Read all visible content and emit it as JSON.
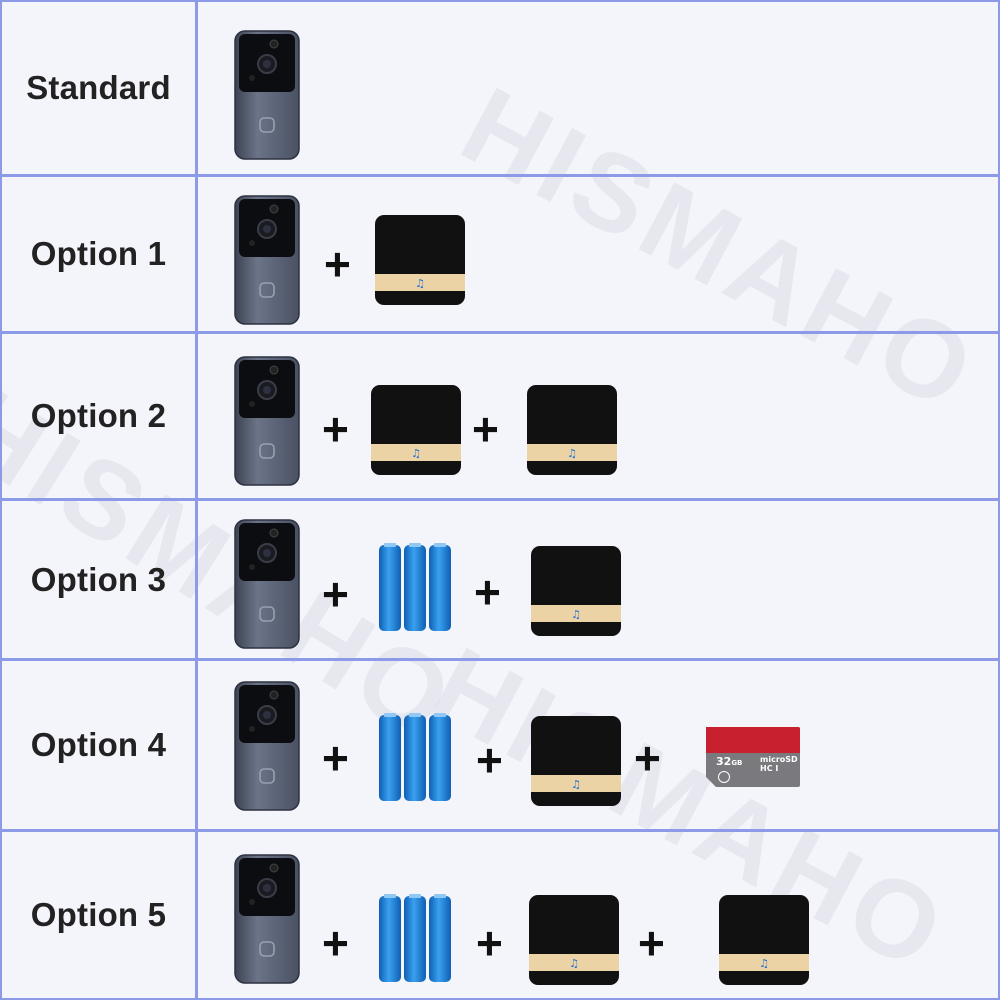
{
  "watermark": "HISMAHO",
  "rows": [
    {
      "label": "Standard"
    },
    {
      "label": "Option 1"
    },
    {
      "label": "Option 2"
    },
    {
      "label": "Option 3"
    },
    {
      "label": "Option 4"
    },
    {
      "label": "Option 5"
    }
  ],
  "plus_sign": "+",
  "sd_card": {
    "capacity": "32",
    "unit": "GB",
    "brand": "micro",
    "format": "SD",
    "class_mark": "HC I"
  },
  "colors": {
    "border": "#8d9ae8",
    "doorbell_body": "#5a6378",
    "chime_body": "#111111",
    "chime_strip": "#e8cfa0",
    "battery": "#1f7fd8",
    "sd_red": "#c8202e",
    "sd_gray": "#7a7a7e"
  }
}
